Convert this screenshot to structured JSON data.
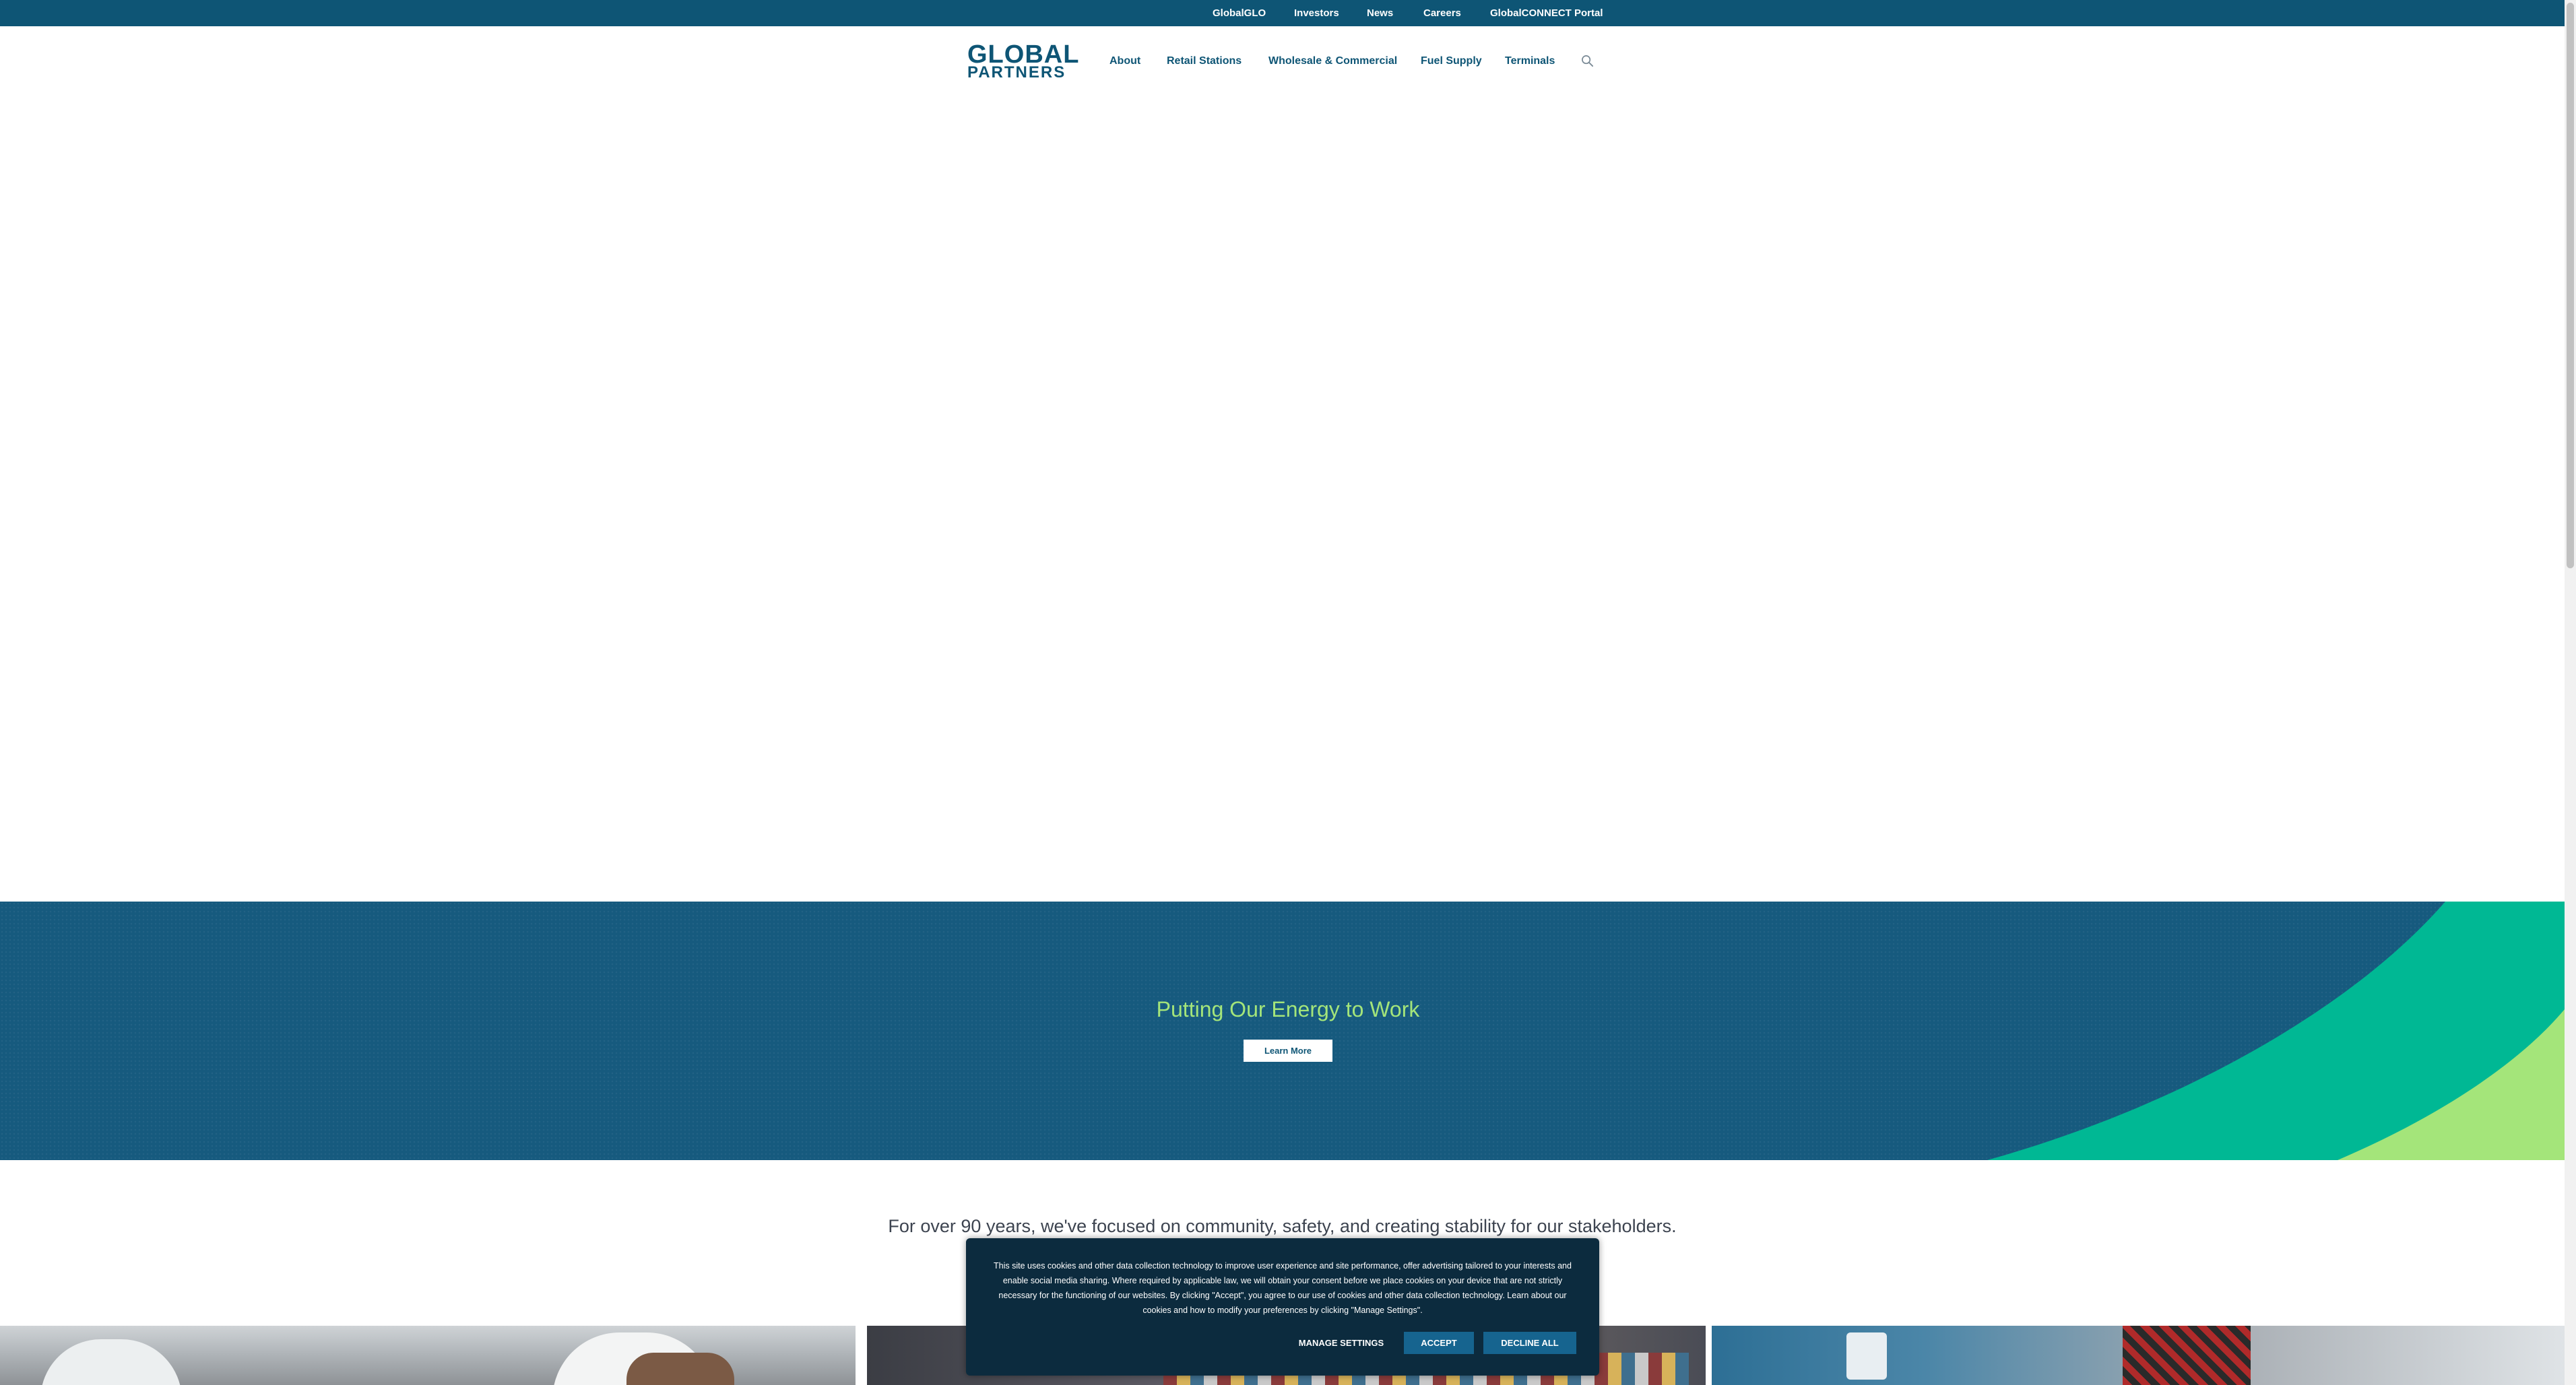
{
  "utility_nav": {
    "links": [
      "GlobalGLO",
      "Investors",
      "News",
      "Careers",
      "GlobalCONNECT Portal"
    ]
  },
  "header": {
    "logo_line1": "GLOBAL",
    "logo_line2": "PARTNERS",
    "nav": [
      "About",
      "Retail Stations",
      "Wholesale & Commercial",
      "Fuel Supply",
      "Terminals"
    ]
  },
  "banner": {
    "title": "Putting Our Energy to Work",
    "button_label": "Learn More"
  },
  "intro": {
    "text": "For over 90 years, we've focused on community, safety, and creating stability for our stakeholders."
  },
  "cookie_banner": {
    "text": "This site uses cookies and other data collection technology to improve user experience and site performance, offer advertising tailored to your interests and enable social media sharing. Where required by applicable law, we will obtain your consent before we place cookies on your device that are not strictly necessary for the functioning of our websites. By clicking \"Accept\", you agree to our use of cookies and other data collection technology. Learn about our cookies and how to modify your preferences by clicking \"Manage Settings\".",
    "manage_label": "MANAGE SETTINGS",
    "accept_label": "ACCEPT",
    "decline_label": "DECLINE ALL"
  },
  "colors": {
    "brand_navy": "#0e5575",
    "banner_blue": "#165a7e",
    "accent_teal": "#00b894",
    "accent_green": "#a4e57a",
    "cookie_bg": "#0c2b3e"
  },
  "icons": [
    "search-icon"
  ]
}
